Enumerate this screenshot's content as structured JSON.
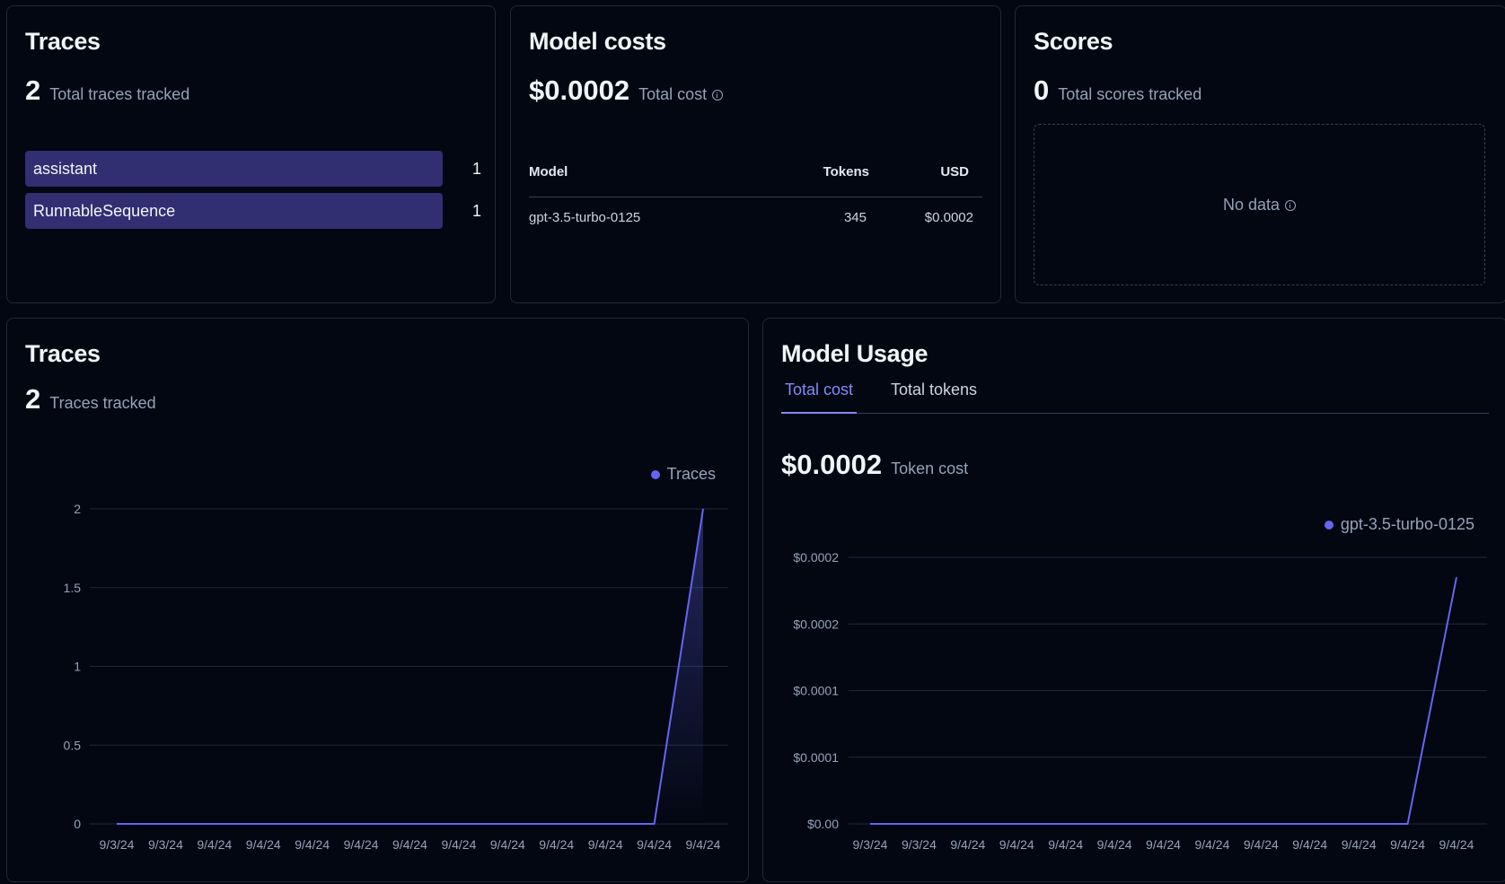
{
  "traces_card": {
    "title": "Traces",
    "total": "2",
    "total_label": "Total traces tracked",
    "bars": [
      {
        "name": "assistant",
        "count": "1",
        "fraction": 1.0
      },
      {
        "name": "RunnableSequence",
        "count": "1",
        "fraction": 1.0
      }
    ]
  },
  "costs_card": {
    "title": "Model costs",
    "total": "$0.0002",
    "total_label": "Total cost",
    "table": {
      "headers": [
        "Model",
        "Tokens",
        "USD"
      ],
      "rows": [
        [
          "gpt-3.5-turbo-0125",
          "345",
          "$0.0002"
        ]
      ]
    }
  },
  "scores_card": {
    "title": "Scores",
    "total": "0",
    "total_label": "Total scores tracked",
    "empty_text": "No data"
  },
  "traces_chart_card": {
    "title": "Traces",
    "total": "2",
    "total_label": "Traces tracked",
    "legend": "Traces"
  },
  "usage_card": {
    "title": "Model Usage",
    "tabs": [
      "Total cost",
      "Total tokens"
    ],
    "active_tab": "Total cost",
    "total": "$0.0002",
    "total_label": "Token cost",
    "legend": "gpt-3.5-turbo-0125"
  },
  "colors": {
    "accent": "#6366f1",
    "bar": "#312e72",
    "background": "#030712"
  },
  "chart_data": [
    {
      "type": "area",
      "title": "",
      "xlabel": "",
      "ylabel": "",
      "ylim": [
        0,
        2
      ],
      "yticks": [
        0,
        0.5,
        1,
        1.5,
        2
      ],
      "ytick_labels": [
        "0",
        "0.5",
        "1",
        "1.5",
        "2"
      ],
      "categories": [
        "9/3/24",
        "9/3/24",
        "9/4/24",
        "9/4/24",
        "9/4/24",
        "9/4/24",
        "9/4/24",
        "9/4/24",
        "9/4/24",
        "9/4/24",
        "9/4/24",
        "9/4/24",
        "9/4/24"
      ],
      "series": [
        {
          "name": "Traces",
          "values": [
            0,
            0,
            0,
            0,
            0,
            0,
            0,
            0,
            0,
            0,
            0,
            0,
            2
          ]
        }
      ],
      "grid": true,
      "legend": "top-right"
    },
    {
      "type": "line",
      "title": "",
      "xlabel": "",
      "ylabel": "",
      "ylim": [
        0,
        0.0002
      ],
      "yticks": [
        0,
        5e-05,
        0.0001,
        0.00015,
        0.0002
      ],
      "ytick_labels": [
        "$0.00",
        "$0.0001",
        "$0.0001",
        "$0.0002",
        "$0.0002"
      ],
      "categories": [
        "9/3/24",
        "9/3/24",
        "9/4/24",
        "9/4/24",
        "9/4/24",
        "9/4/24",
        "9/4/24",
        "9/4/24",
        "9/4/24",
        "9/4/24",
        "9/4/24",
        "9/4/24",
        "9/4/24"
      ],
      "series": [
        {
          "name": "gpt-3.5-turbo-0125",
          "values": [
            0,
            0,
            0,
            0,
            0,
            0,
            0,
            0,
            0,
            0,
            0,
            0,
            0.000185
          ]
        }
      ],
      "grid": true,
      "legend": "top-right"
    }
  ]
}
